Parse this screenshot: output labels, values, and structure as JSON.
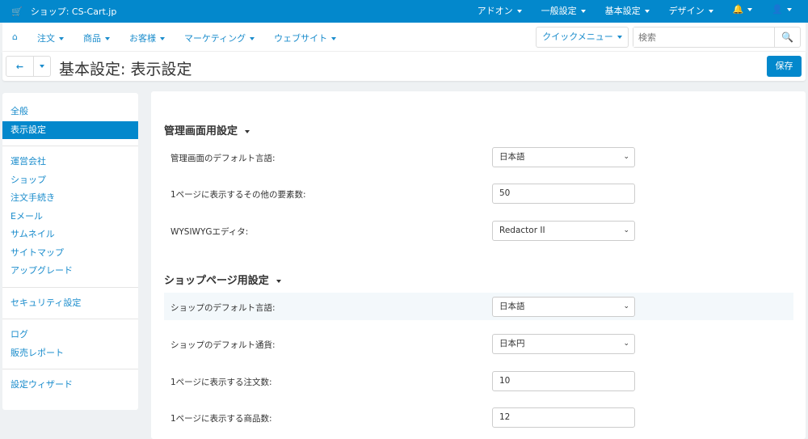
{
  "topbar": {
    "shop": "ショップ: CS-Cart.jp",
    "menu": [
      "アドオン",
      "一般設定",
      "基本設定",
      "デザイン"
    ]
  },
  "nav": {
    "items": [
      "注文",
      "商品",
      "お客様",
      "マーケティング",
      "ウェブサイト"
    ],
    "quick_menu": "クイックメニュー",
    "search_placeholder": "検索"
  },
  "toolbar": {
    "title": "基本設定: 表示設定",
    "save": "保存"
  },
  "sidebar": {
    "groups": [
      [
        "全般",
        "表示設定"
      ],
      [
        "運営会社",
        "ショップ",
        "注文手続き",
        "Eメール",
        "サムネイル",
        "サイトマップ",
        "アップグレード"
      ],
      [
        "セキュリティ設定"
      ],
      [
        "ログ",
        "販売レポート"
      ],
      [
        "設定ウィザード"
      ]
    ]
  },
  "main": {
    "sections": [
      {
        "title": "管理画面用設定",
        "rows": [
          {
            "label": "管理画面のデフォルト言語:",
            "value": "日本語",
            "type": "select"
          },
          {
            "label": "1ページに表示するその他の要素数:",
            "value": "50",
            "type": "input"
          },
          {
            "label": "WYSIWYGエディタ:",
            "value": "Redactor II",
            "type": "select"
          }
        ]
      },
      {
        "title": "ショップページ用設定",
        "rows": [
          {
            "label": "ショップのデフォルト言語:",
            "value": "日本語",
            "type": "select"
          },
          {
            "label": "ショップのデフォルト通貨:",
            "value": "日本円",
            "type": "select"
          },
          {
            "label": "1ページに表示する注文数:",
            "value": "10",
            "type": "input"
          },
          {
            "label": "1ページに表示する商品数:",
            "value": "12",
            "type": "input"
          }
        ]
      }
    ]
  }
}
